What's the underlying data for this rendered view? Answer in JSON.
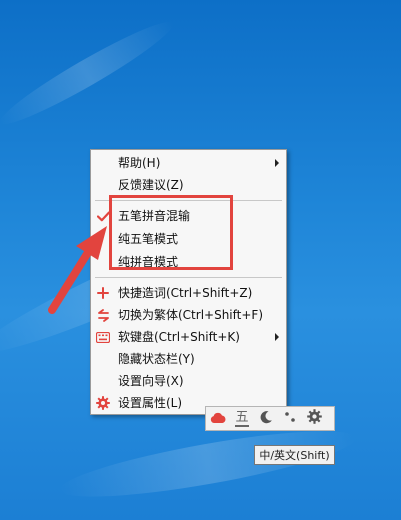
{
  "menu": {
    "items": [
      {
        "label": "帮助(H)",
        "icon": "none",
        "submenu": true
      },
      {
        "label": "反馈建议(Z)",
        "icon": "none",
        "submenu": false
      },
      {
        "label": "五笔拼音混输",
        "icon": "checkmark-icon",
        "checked": true,
        "submenu": false
      },
      {
        "label": "纯五笔模式",
        "icon": "none",
        "submenu": false
      },
      {
        "label": "纯拼音模式",
        "icon": "none",
        "submenu": false
      },
      {
        "label": "快捷造词(Ctrl+Shift+Z)",
        "icon": "plus-icon",
        "submenu": false
      },
      {
        "label": "切换为繁体(Ctrl+Shift+F)",
        "icon": "convert-icon",
        "submenu": false
      },
      {
        "label": "软键盘(Ctrl+Shift+K)",
        "icon": "keyboard-icon",
        "submenu": true
      },
      {
        "label": "隐藏状态栏(Y)",
        "icon": "none",
        "submenu": false
      },
      {
        "label": "设置向导(X)",
        "icon": "none",
        "submenu": false
      },
      {
        "label": "设置属性(L)",
        "icon": "gear-icon",
        "submenu": false
      }
    ]
  },
  "statusbar": {
    "icons": [
      "cloud-icon",
      "wubi-icon",
      "moon-icon",
      "punctuation-icon",
      "gear-icon"
    ],
    "wubi_glyph": "五"
  },
  "tooltip": {
    "text": "中/英文(Shift)"
  },
  "colors": {
    "accent": "#e2443e",
    "desktop": "#1f86d8"
  }
}
